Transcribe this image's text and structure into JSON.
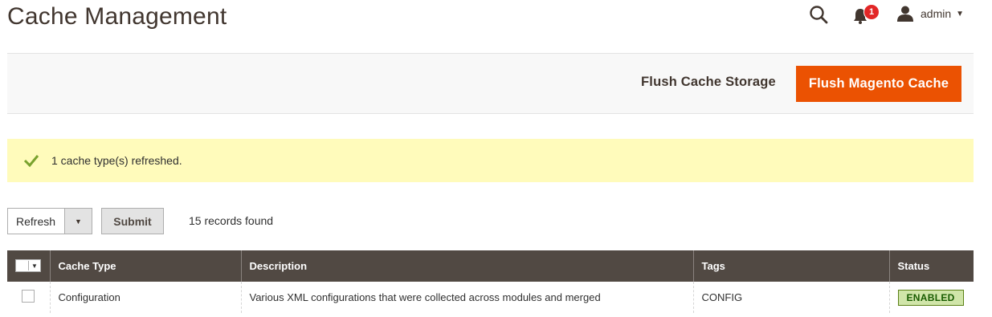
{
  "header": {
    "title": "Cache Management",
    "notifications_count": "1",
    "user_name": "admin"
  },
  "actions": {
    "flush_storage_label": "Flush Cache Storage",
    "flush_magento_label": "Flush Magento Cache"
  },
  "message": {
    "text": "1 cache type(s) refreshed."
  },
  "massaction": {
    "selected": "Refresh",
    "submit_label": "Submit",
    "records_text": "15 records found"
  },
  "grid": {
    "columns": [
      "Cache Type",
      "Description",
      "Tags",
      "Status"
    ],
    "rows": [
      {
        "cache_type": "Configuration",
        "description": "Various XML configurations that were collected across modules and merged",
        "tags": "CONFIG",
        "status": "ENABLED"
      }
    ]
  },
  "colors": {
    "accent": "#eb5202",
    "header_bg": "#514943",
    "message_bg": "#fffbbb",
    "status_enabled_bg": "#d0e5a9"
  },
  "icons": [
    "search-icon",
    "bell-icon",
    "user-icon",
    "chevron-down-icon",
    "checkmark-icon"
  ]
}
